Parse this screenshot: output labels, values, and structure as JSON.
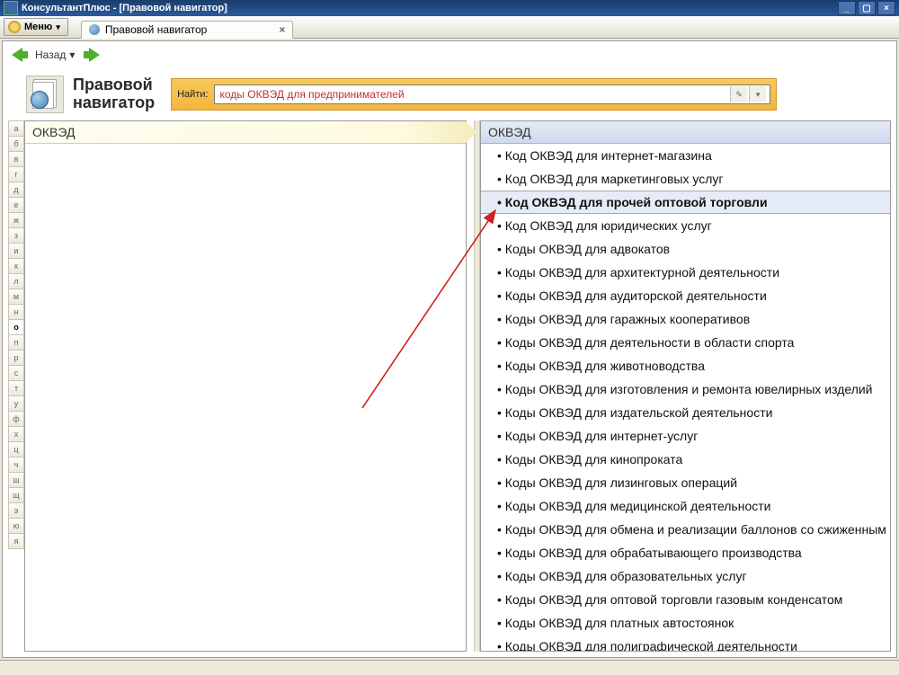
{
  "window_title": "КонсультантПлюс - [Правовой навигатор]",
  "menu": {
    "label": "Меню"
  },
  "tab": {
    "label": "Правовой навигатор"
  },
  "nav": {
    "back": "Назад",
    "back_caret": "▾"
  },
  "page_header": {
    "line1": "Правовой",
    "line2": "навигатор"
  },
  "search": {
    "label": "Найти:",
    "value": "коды ОКВЭД для предпринимателей"
  },
  "left_pane": {
    "header": "ОКВЭД"
  },
  "right_pane": {
    "header": "ОКВЭД"
  },
  "alpha_index": [
    "а",
    "б",
    "в",
    "г",
    "д",
    "е",
    "ж",
    "з",
    "и",
    "к",
    "л",
    "м",
    "н",
    "о",
    "п",
    "р",
    "с",
    "т",
    "у",
    "ф",
    "х",
    "ц",
    "ч",
    "ш",
    "щ",
    "э",
    "ю",
    "я"
  ],
  "alpha_active": "о",
  "right_items": [
    {
      "text": "Код ОКВЭД для интернет-магазина",
      "hl": false
    },
    {
      "text": "Код ОКВЭД для маркетинговых услуг",
      "hl": false
    },
    {
      "text": "Код ОКВЭД для прочей оптовой торговли",
      "hl": true
    },
    {
      "text": "Код ОКВЭД для юридических услуг",
      "hl": false
    },
    {
      "text": "Коды ОКВЭД для адвокатов",
      "hl": false
    },
    {
      "text": "Коды ОКВЭД для архитектурной деятельности",
      "hl": false
    },
    {
      "text": "Коды ОКВЭД для аудиторской деятельности",
      "hl": false
    },
    {
      "text": "Коды ОКВЭД для гаражных кооперативов",
      "hl": false
    },
    {
      "text": "Коды ОКВЭД для деятельности в области спорта",
      "hl": false
    },
    {
      "text": "Коды ОКВЭД для животноводства",
      "hl": false
    },
    {
      "text": "Коды ОКВЭД для изготовления и ремонта ювелирных изделий",
      "hl": false
    },
    {
      "text": "Коды ОКВЭД для издательской деятельности",
      "hl": false
    },
    {
      "text": "Коды ОКВЭД для интернет-услуг",
      "hl": false
    },
    {
      "text": "Коды ОКВЭД для кинопроката",
      "hl": false
    },
    {
      "text": "Коды ОКВЭД для лизинговых операций",
      "hl": false
    },
    {
      "text": "Коды ОКВЭД для медицинской деятельности",
      "hl": false
    },
    {
      "text": "Коды ОКВЭД для обмена и реализации баллонов со сжиженным газом",
      "hl": false
    },
    {
      "text": "Коды ОКВЭД для обрабатывающего производства",
      "hl": false
    },
    {
      "text": "Коды ОКВЭД для образовательных услуг",
      "hl": false
    },
    {
      "text": "Коды ОКВЭД для оптовой торговли газовым конденсатом",
      "hl": false
    },
    {
      "text": "Коды ОКВЭД для платных автостоянок",
      "hl": false
    },
    {
      "text": "Коды ОКВЭД для полиграфической деятельности",
      "hl": false
    }
  ]
}
